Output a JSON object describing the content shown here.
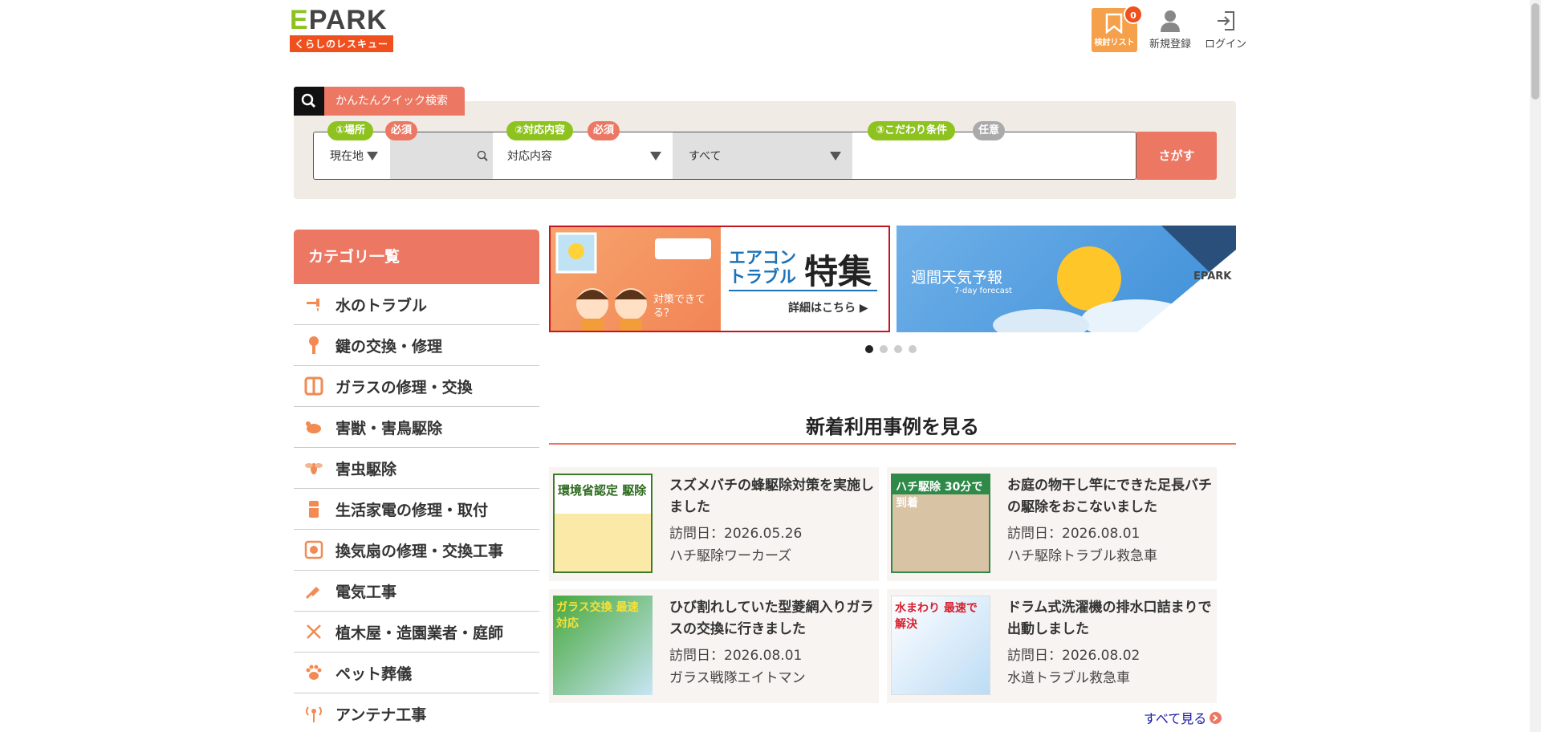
{
  "header": {
    "logo_word_e": "E",
    "logo_word_rest": "PARK",
    "logo_sub": "くらしのレスキュー",
    "wishlist_label": "検討リスト",
    "wishlist_count": "0",
    "signup_label": "新規登録",
    "login_label": "ログイン"
  },
  "search": {
    "tab_label": "かんたんクイック検索",
    "place_tag": "①場所",
    "place_req": "必須",
    "place_select": "現在地",
    "service_tag": "②対応内容",
    "service_req": "必須",
    "service_select": "対応内容",
    "all_select": "すべて",
    "condition_tag": "③こだわり条件",
    "condition_opt": "任意",
    "button_label": "さがす"
  },
  "categories": {
    "title": "カテゴリ一覧",
    "items": [
      {
        "label": "水のトラブル",
        "icon": "faucet-icon"
      },
      {
        "label": "鍵の交換・修理",
        "icon": "key-icon"
      },
      {
        "label": "ガラスの修理・交換",
        "icon": "window-icon"
      },
      {
        "label": "害獣・害鳥駆除",
        "icon": "rat-icon"
      },
      {
        "label": "害虫駆除",
        "icon": "bee-icon"
      },
      {
        "label": "生活家電の修理・取付",
        "icon": "appliance-icon"
      },
      {
        "label": "換気扇の修理・交換工事",
        "icon": "fan-icon"
      },
      {
        "label": "電気工事",
        "icon": "plug-icon"
      },
      {
        "label": "植木屋・造園業者・庭師",
        "icon": "scissors-icon"
      },
      {
        "label": "ペット葬儀",
        "icon": "paw-icon"
      },
      {
        "label": "アンテナ工事",
        "icon": "antenna-icon"
      }
    ]
  },
  "banners": {
    "b1_headline_1": "エアコン",
    "b1_headline_2": "トラブル",
    "b1_big": "特集",
    "b1_question": "対策できてる？",
    "b1_more": "詳細はこちら ▶",
    "b2_title": "週間天気予報",
    "b2_sub": "7-day forecast",
    "b2_logo": "EPARK"
  },
  "news": {
    "title": "新着利用事例を見る",
    "see_all": "すべて見る",
    "cards": [
      {
        "title": "スズメバチの蜂駆除対策を実施しました",
        "date": "訪問日：2026.05.26",
        "shop": "ハチ駆除ワーカーズ",
        "img_text": "環境省認定 駆除"
      },
      {
        "title": "お庭の物干し竿にできた足長バチの駆除をおこないました",
        "date": "訪問日：2026.08.01",
        "shop": "ハチ駆除トラブル救急車",
        "img_text": "ハチ駆除 30分で到着"
      },
      {
        "title": "ひび割れしていた型菱網入りガラスの交換に行きました",
        "date": "訪問日：2026.08.01",
        "shop": "ガラス戦隊エイトマン",
        "img_text": "ガラス交換 最速対応"
      },
      {
        "title": "ドラム式洗濯機の排水口詰まりで出動しました",
        "date": "訪問日：2026.08.02",
        "shop": "水道トラブル救急車",
        "img_text": "水まわり 最速で解決"
      }
    ]
  }
}
